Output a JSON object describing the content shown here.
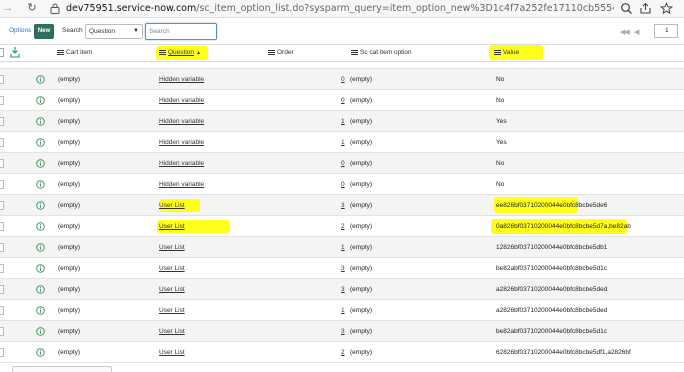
{
  "browser": {
    "url_domain": "dev75951.service-now.com",
    "url_path": "/sc_item_option_list.do?sysparm_query=item_option_new%3D1c4f7a252fe17110cb5554492799b62d%5EORite..."
  },
  "toolbar": {
    "options_label": "Options",
    "new_label": "New",
    "search_label": "Search",
    "search_field_value": "Question",
    "search_placeholder": "Search",
    "page_number": "1"
  },
  "columns": {
    "cart_item": "Cart item",
    "question": "Question",
    "order": "Order",
    "sc_cat_item_option": "Sc cat item option",
    "value": "Value"
  },
  "rows": [
    {
      "cart_item": "(empty)",
      "question": "Hidden variable",
      "order": "0",
      "sc_cat_item_option": "(empty)",
      "value": "No"
    },
    {
      "cart_item": "(empty)",
      "question": "Hidden variable",
      "order": "0",
      "sc_cat_item_option": "(empty)",
      "value": "No"
    },
    {
      "cart_item": "(empty)",
      "question": "Hidden variable",
      "order": "1",
      "sc_cat_item_option": "(empty)",
      "value": "Yes"
    },
    {
      "cart_item": "(empty)",
      "question": "Hidden variable",
      "order": "1",
      "sc_cat_item_option": "(empty)",
      "value": "Yes"
    },
    {
      "cart_item": "(empty)",
      "question": "Hidden variable",
      "order": "0",
      "sc_cat_item_option": "(empty)",
      "value": "No"
    },
    {
      "cart_item": "(empty)",
      "question": "Hidden variable",
      "order": "0",
      "sc_cat_item_option": "(empty)",
      "value": "No"
    },
    {
      "cart_item": "(empty)",
      "question": "User List",
      "order": "3",
      "sc_cat_item_option": "(empty)",
      "value": "ee826bf03710200044e0bfc8bcbe5de6"
    },
    {
      "cart_item": "(empty)",
      "question": "User List",
      "order": "2",
      "sc_cat_item_option": "(empty)",
      "value": "0a826bf03710200044e0bfc8bcbe5d7a,be82abf..."
    },
    {
      "cart_item": "(empty)",
      "question": "User List",
      "order": "1",
      "sc_cat_item_option": "(empty)",
      "value": "12826bf03710200044e0bfc8bcbe5db1"
    },
    {
      "cart_item": "(empty)",
      "question": "User List",
      "order": "3",
      "sc_cat_item_option": "(empty)",
      "value": "be82abf03710200044e0bfc8bcbe5d1c"
    },
    {
      "cart_item": "(empty)",
      "question": "User List",
      "order": "3",
      "sc_cat_item_option": "(empty)",
      "value": "a2826bf03710200044e0bfc8bcbe5ded"
    },
    {
      "cart_item": "(empty)",
      "question": "User List",
      "order": "1",
      "sc_cat_item_option": "(empty)",
      "value": "a2826bf03710200044e0bfc8bcbe5ded"
    },
    {
      "cart_item": "(empty)",
      "question": "User List",
      "order": "3",
      "sc_cat_item_option": "(empty)",
      "value": "be82abf03710200044e0bfc8bcbe5d1c"
    },
    {
      "cart_item": "(empty)",
      "question": "User List",
      "order": "2",
      "sc_cat_item_option": "(empty)",
      "value": "62826bf03710200044e0bfc8bcbe5df1,a2826bf..."
    }
  ],
  "colors": {
    "highlight": "#ffff1a",
    "new_button": "#2f6f5f",
    "info_icon": "#3a8f5a",
    "link_blue": "#2a6ebb"
  }
}
